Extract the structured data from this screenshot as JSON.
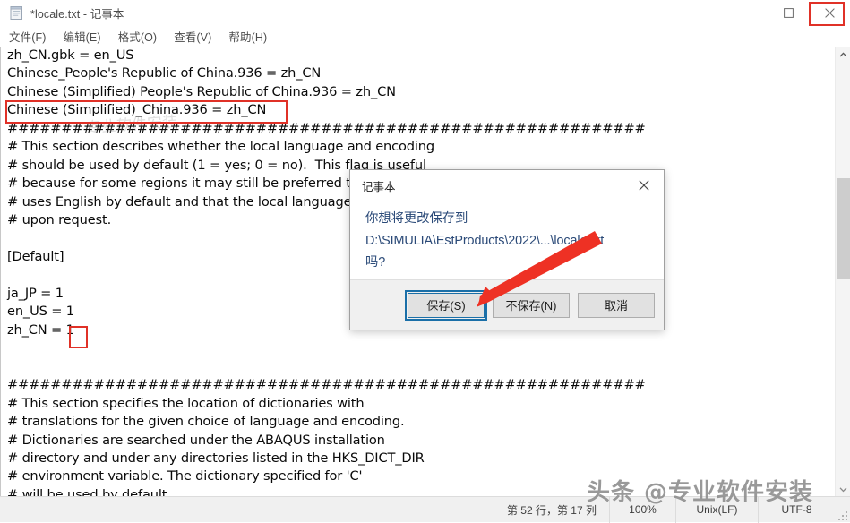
{
  "window": {
    "title": "*locale.txt - 记事本",
    "icon": "notepad-icon",
    "minimize_label": "最小化",
    "maximize_label": "最大化",
    "close_label": "关闭"
  },
  "menubar": {
    "items": [
      {
        "label": "文件(F)",
        "name": "menu-file"
      },
      {
        "label": "编辑(E)",
        "name": "menu-edit"
      },
      {
        "label": "格式(O)",
        "name": "menu-format"
      },
      {
        "label": "查看(V)",
        "name": "menu-view"
      },
      {
        "label": "帮助(H)",
        "name": "menu-help"
      }
    ]
  },
  "editor": {
    "content": "zh_CN.gbk = en_US\nChinese_People's Republic of China.936 = zh_CN\nChinese (Simplified) People's Republic of China.936 = zh_CN\nChinese (Simplified)_China.936 = zh_CN\n###########################################################\n# This section describes whether the local language and encoding\n# should be used by default (1 = yes; 0 = no).  This flag is useful\n# because for some regions it may still be preferred that ABAQUS\n# uses English by default and that the local language be invoked\n# upon request.\n\n[Default]\n\nja_JP = 1\nen_US = 1\nzh_CN = 1\n\n\n###########################################################\n# This section specifies the location of dictionaries with\n# translations for the given choice of language and encoding.\n# Dictionaries are searched under the ABAQUS installation\n# directory and under any directories listed in the HKS_DICT_DIR\n# environment variable. The dictionary specified for 'C'\n# will be used by default."
  },
  "statusbar": {
    "position": "第 52 行，第 17 列",
    "zoom": "100%",
    "line_ending": "Unix(LF)",
    "encoding": "UTF-8"
  },
  "dialog": {
    "title": "记事本",
    "close_label": "关闭",
    "message": "你想将更改保存到\nD:\\SIMULIA\\EstProducts\\2022\\...\\locale.txt\n吗?",
    "buttons": [
      {
        "label": "保存(S)",
        "name": "dialog-save-button",
        "focused": true
      },
      {
        "label": "不保存(N)",
        "name": "dialog-dont-save-button",
        "focused": false
      },
      {
        "label": "取消",
        "name": "dialog-cancel-button",
        "focused": false
      }
    ]
  },
  "annotations": {
    "highlight_line": "Chinese (Simplified)_China.936 = zh_CN",
    "highlight_value": "1",
    "arrow_target": "保存(S)",
    "accent_color": "#e03127",
    "focus_color": "#1a6fa8"
  },
  "watermark": {
    "text": "头条 @专业软件安装",
    "ghost": "专业软件安装"
  }
}
